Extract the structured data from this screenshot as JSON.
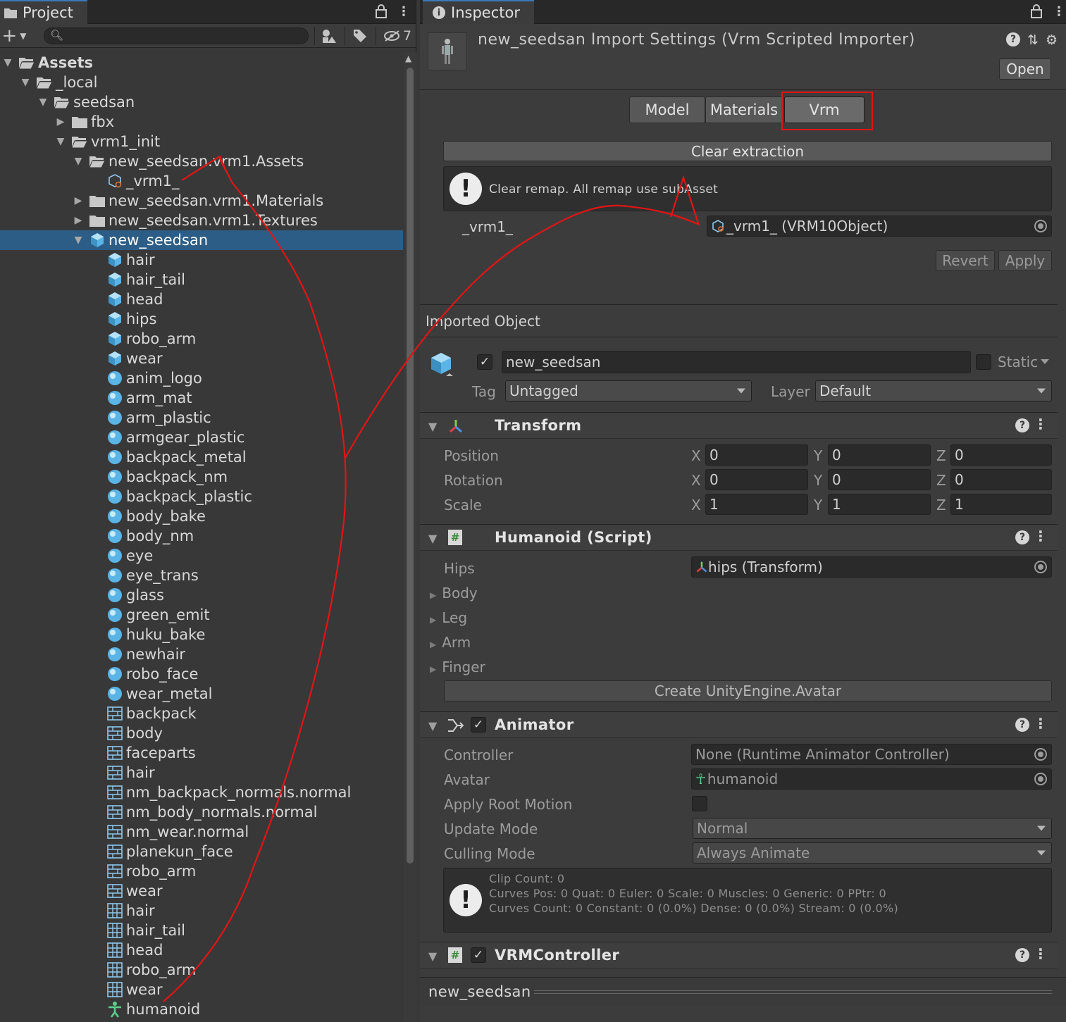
{
  "project": {
    "tab_label": "Project",
    "hidden_count": "7",
    "tree": [
      {
        "label": "Assets",
        "depth": 0,
        "arrow": "down",
        "icon": "folder-open-icon",
        "bold": true
      },
      {
        "label": "_local",
        "depth": 1,
        "arrow": "down",
        "icon": "folder-open-icon"
      },
      {
        "label": "seedsan",
        "depth": 2,
        "arrow": "down",
        "icon": "folder-open-icon"
      },
      {
        "label": "fbx",
        "depth": 3,
        "arrow": "right",
        "icon": "folder-icon"
      },
      {
        "label": "vrm1_init",
        "depth": 3,
        "arrow": "down",
        "icon": "folder-open-icon"
      },
      {
        "label": "new_seedsan.vrm1.Assets",
        "depth": 4,
        "arrow": "down",
        "icon": "folder-open-icon"
      },
      {
        "label": "_vrm1_",
        "depth": 5,
        "arrow": "none",
        "icon": "scriptable-object-icon"
      },
      {
        "label": "new_seedsan.vrm1.Materials",
        "depth": 4,
        "arrow": "right",
        "icon": "folder-icon"
      },
      {
        "label": "new_seedsan.vrm1.Textures",
        "depth": 4,
        "arrow": "right",
        "icon": "folder-icon"
      },
      {
        "label": "new_seedsan",
        "depth": 4,
        "arrow": "down",
        "icon": "prefab-icon",
        "selected": true
      },
      {
        "label": "hair",
        "depth": 5,
        "arrow": "none",
        "icon": "prefab-icon"
      },
      {
        "label": "hair_tail",
        "depth": 5,
        "arrow": "none",
        "icon": "prefab-icon"
      },
      {
        "label": "head",
        "depth": 5,
        "arrow": "none",
        "icon": "prefab-icon"
      },
      {
        "label": "hips",
        "depth": 5,
        "arrow": "none",
        "icon": "prefab-icon"
      },
      {
        "label": "robo_arm",
        "depth": 5,
        "arrow": "none",
        "icon": "prefab-icon"
      },
      {
        "label": "wear",
        "depth": 5,
        "arrow": "none",
        "icon": "prefab-icon"
      },
      {
        "label": "anim_logo",
        "depth": 5,
        "arrow": "none",
        "icon": "material-icon"
      },
      {
        "label": "arm_mat",
        "depth": 5,
        "arrow": "none",
        "icon": "material-icon"
      },
      {
        "label": "arm_plastic",
        "depth": 5,
        "arrow": "none",
        "icon": "material-icon"
      },
      {
        "label": "armgear_plastic",
        "depth": 5,
        "arrow": "none",
        "icon": "material-icon"
      },
      {
        "label": "backpack_metal",
        "depth": 5,
        "arrow": "none",
        "icon": "material-icon"
      },
      {
        "label": "backpack_nm",
        "depth": 5,
        "arrow": "none",
        "icon": "material-icon"
      },
      {
        "label": "backpack_plastic",
        "depth": 5,
        "arrow": "none",
        "icon": "material-icon"
      },
      {
        "label": "body_bake",
        "depth": 5,
        "arrow": "none",
        "icon": "material-icon"
      },
      {
        "label": "body_nm",
        "depth": 5,
        "arrow": "none",
        "icon": "material-icon"
      },
      {
        "label": "eye",
        "depth": 5,
        "arrow": "none",
        "icon": "material-icon"
      },
      {
        "label": "eye_trans",
        "depth": 5,
        "arrow": "none",
        "icon": "material-icon"
      },
      {
        "label": "glass",
        "depth": 5,
        "arrow": "none",
        "icon": "material-icon"
      },
      {
        "label": "green_emit",
        "depth": 5,
        "arrow": "none",
        "icon": "material-icon"
      },
      {
        "label": "huku_bake",
        "depth": 5,
        "arrow": "none",
        "icon": "material-icon"
      },
      {
        "label": "newhair",
        "depth": 5,
        "arrow": "none",
        "icon": "material-icon"
      },
      {
        "label": "robo_face",
        "depth": 5,
        "arrow": "none",
        "icon": "material-icon"
      },
      {
        "label": "wear_metal",
        "depth": 5,
        "arrow": "none",
        "icon": "material-icon"
      },
      {
        "label": "backpack",
        "depth": 5,
        "arrow": "none",
        "icon": "texture-icon"
      },
      {
        "label": "body",
        "depth": 5,
        "arrow": "none",
        "icon": "texture-icon"
      },
      {
        "label": "faceparts",
        "depth": 5,
        "arrow": "none",
        "icon": "texture-icon"
      },
      {
        "label": "hair",
        "depth": 5,
        "arrow": "none",
        "icon": "texture-icon"
      },
      {
        "label": "nm_backpack_normals.normal",
        "depth": 5,
        "arrow": "none",
        "icon": "texture-icon"
      },
      {
        "label": "nm_body_normals.normal",
        "depth": 5,
        "arrow": "none",
        "icon": "texture-icon"
      },
      {
        "label": "nm_wear.normal",
        "depth": 5,
        "arrow": "none",
        "icon": "texture-icon"
      },
      {
        "label": "planekun_face",
        "depth": 5,
        "arrow": "none",
        "icon": "texture-icon"
      },
      {
        "label": "robo_arm",
        "depth": 5,
        "arrow": "none",
        "icon": "texture-icon"
      },
      {
        "label": "wear",
        "depth": 5,
        "arrow": "none",
        "icon": "texture-icon"
      },
      {
        "label": "hair",
        "depth": 5,
        "arrow": "none",
        "icon": "mesh-icon"
      },
      {
        "label": "hair_tail",
        "depth": 5,
        "arrow": "none",
        "icon": "mesh-icon"
      },
      {
        "label": "head",
        "depth": 5,
        "arrow": "none",
        "icon": "mesh-icon"
      },
      {
        "label": "robo_arm",
        "depth": 5,
        "arrow": "none",
        "icon": "mesh-icon"
      },
      {
        "label": "wear",
        "depth": 5,
        "arrow": "none",
        "icon": "mesh-icon"
      },
      {
        "label": "humanoid",
        "depth": 5,
        "arrow": "none",
        "icon": "avatar-icon"
      }
    ]
  },
  "inspector": {
    "tab_label": "Inspector",
    "title": "new_seedsan Import Settings (Vrm Scripted Importer)",
    "open_label": "Open",
    "tabs": [
      "Model",
      "Materials",
      "Vrm"
    ],
    "active_tab": "Vrm",
    "clear_extraction": "Clear extraction",
    "help_text": "Clear remap. All remap use subAsset",
    "remap_label": "_vrm1_",
    "remap_value": "_vrm1_ (VRM10Object)",
    "revert_label": "Revert",
    "apply_label": "Apply",
    "imported_object_label": "Imported Object",
    "object_name": "new_seedsan",
    "static_label": "Static",
    "tag_label": "Tag",
    "tag_value": "Untagged",
    "layer_label": "Layer",
    "layer_value": "Default",
    "transform": {
      "name": "Transform",
      "rows": [
        {
          "label": "Position",
          "x": "0",
          "y": "0",
          "z": "0"
        },
        {
          "label": "Rotation",
          "x": "0",
          "y": "0",
          "z": "0"
        },
        {
          "label": "Scale",
          "x": "1",
          "y": "1",
          "z": "1"
        }
      ],
      "axis_x": "X",
      "axis_y": "Y",
      "axis_z": "Z"
    },
    "humanoid": {
      "name": "Humanoid (Script)",
      "hips_label": "Hips",
      "hips_value": "hips (Transform)",
      "folds": [
        "Body",
        "Leg",
        "Arm",
        "Finger"
      ],
      "create_avatar": "Create UnityEngine.Avatar"
    },
    "animator": {
      "name": "Animator",
      "controller_label": "Controller",
      "controller_value": "None (Runtime Animator Controller)",
      "avatar_label": "Avatar",
      "avatar_value": "humanoid",
      "root_motion_label": "Apply Root Motion",
      "update_mode_label": "Update Mode",
      "update_mode_value": "Normal",
      "culling_mode_label": "Culling Mode",
      "culling_mode_value": "Always Animate",
      "info_1": "Clip Count: 0",
      "info_2": "Curves Pos: 0 Quat: 0 Euler: 0 Scale: 0 Muscles: 0 Generic: 0 PPtr: 0",
      "info_3": "Curves Count: 0 Constant: 0 (0.0%) Dense: 0 (0.0%) Stream: 0 (0.0%)"
    },
    "vrm_controller": {
      "name": "VRMController"
    },
    "footer_name": "new_seedsan"
  },
  "colors": {
    "selection": "#2c5d87",
    "annotation_red": "#e31414",
    "icon_blue": "#5ab4e6"
  }
}
